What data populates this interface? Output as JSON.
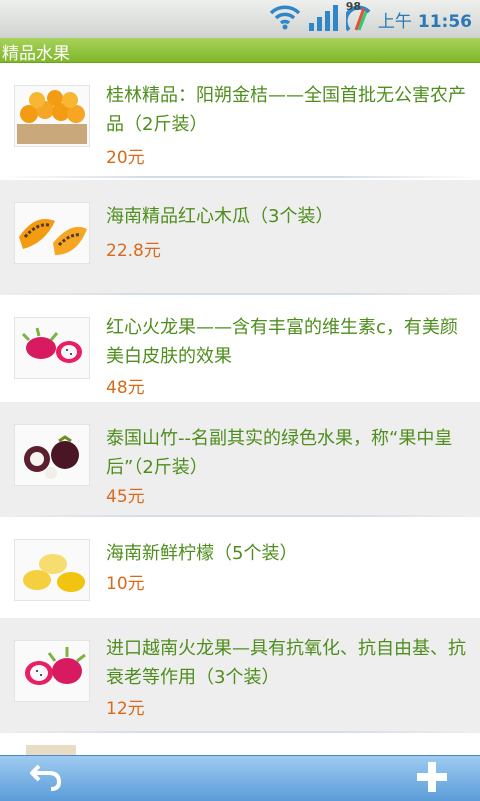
{
  "status": {
    "battery": "98",
    "ampm": "上午",
    "time": "11:56"
  },
  "page": {
    "title": "精品水果"
  },
  "products": [
    {
      "name": "桂林精品：阳朔金桔——全国首批无公害农产品（2斤装）",
      "price": "20元",
      "image": "kumquat"
    },
    {
      "name": "海南精品红心木瓜（3个装）",
      "price": "22.8元",
      "image": "papaya"
    },
    {
      "name": "红心火龙果——含有丰富的维生素c，有美颜美白皮肤的效果",
      "price": "48元",
      "image": "dragon-fruit"
    },
    {
      "name": "泰国山竹--名副其实的绿色水果，称“果中皇后”（2斤装）",
      "price": "45元",
      "image": "mangosteen"
    },
    {
      "name": "海南新鲜柠檬（5个装）",
      "price": "10元",
      "image": "lemon"
    },
    {
      "name": "进口越南火龙果—具有抗氧化、抗自由基、抗衰老等作用（3个装）",
      "price": "12元",
      "image": "dragon-fruit-imported"
    }
  ],
  "toolbar": {
    "back_icon": "back-arrow-icon",
    "add_icon": "plus-icon"
  },
  "colors": {
    "title_green": "#8cc63f",
    "name_green": "#4f8e1e",
    "price_orange": "#d86a1c",
    "toolbar_blue": "#5b9cd8"
  }
}
